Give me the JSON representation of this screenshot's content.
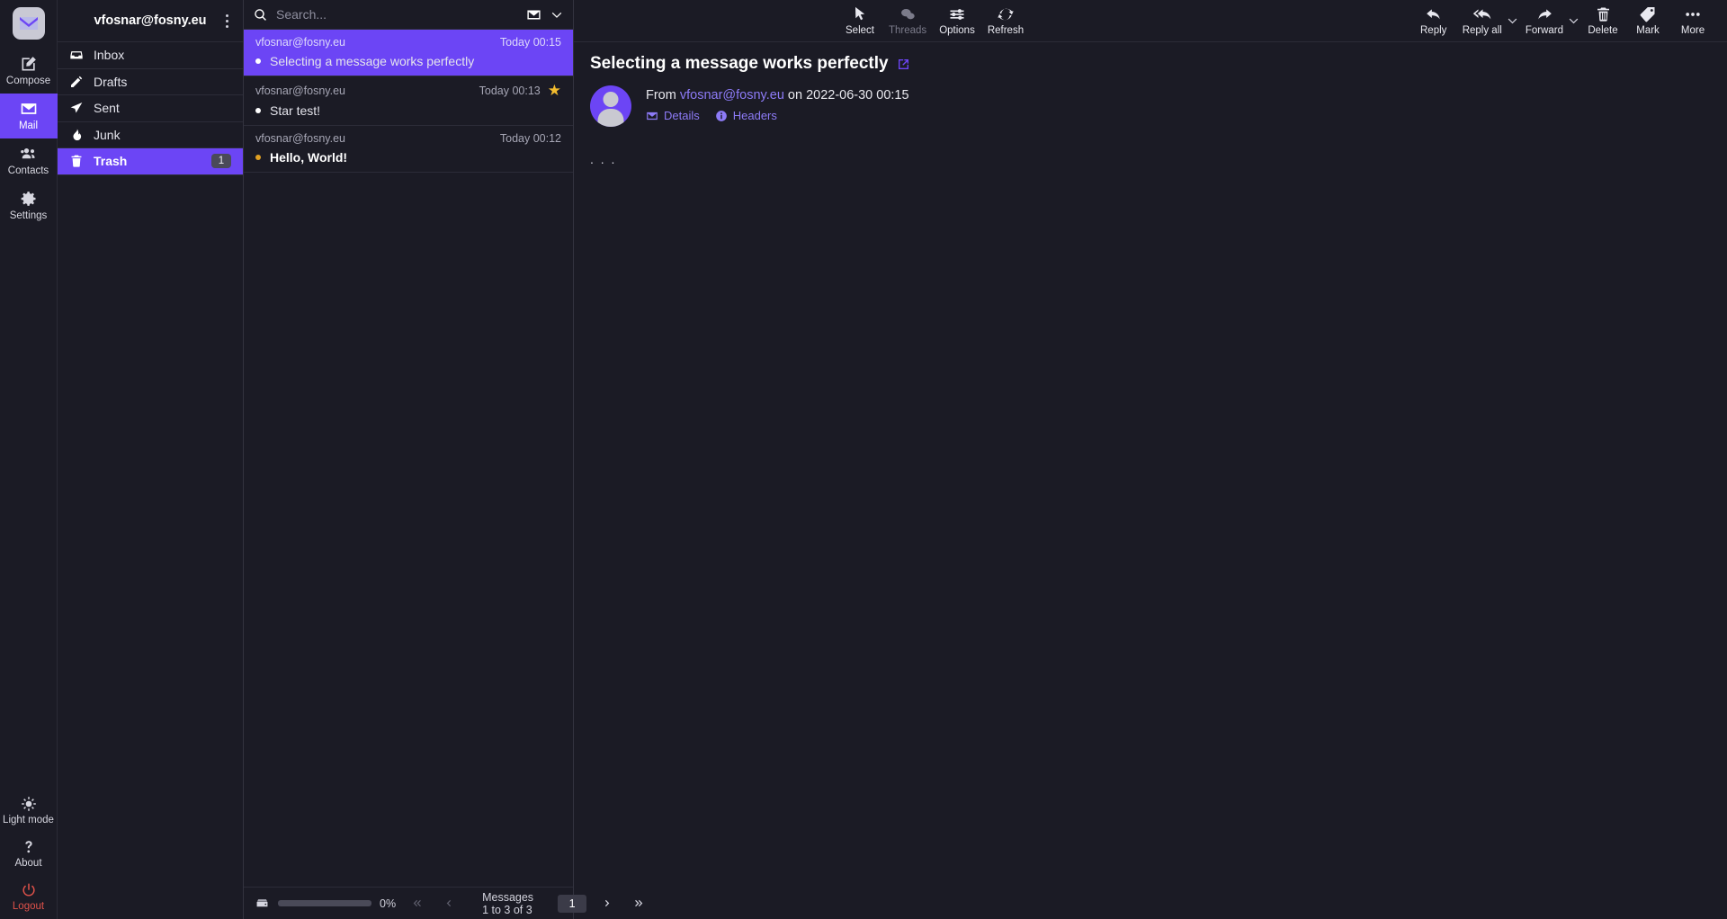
{
  "rail": {
    "logo_icon": "mail-logo-icon",
    "items": [
      {
        "label": "Compose",
        "icon": "compose-pencil-icon",
        "active": false
      },
      {
        "label": "Mail",
        "icon": "envelope-icon",
        "active": true
      },
      {
        "label": "Contacts",
        "icon": "people-icon",
        "active": false
      },
      {
        "label": "Settings",
        "icon": "gear-icon",
        "active": false
      }
    ],
    "bottom_items": [
      {
        "label": "Light mode",
        "icon": "sun-icon"
      },
      {
        "label": "About",
        "icon": "question-icon"
      },
      {
        "label": "Logout",
        "icon": "power-icon"
      }
    ]
  },
  "folders": {
    "account": "vfosnar@fosny.eu",
    "items": [
      {
        "label": "Inbox",
        "icon": "inbox-icon",
        "count": "",
        "active": false
      },
      {
        "label": "Drafts",
        "icon": "pencil-icon",
        "count": "",
        "active": false
      },
      {
        "label": "Sent",
        "icon": "send-icon",
        "count": "",
        "active": false
      },
      {
        "label": "Junk",
        "icon": "fire-icon",
        "count": "",
        "active": false
      },
      {
        "label": "Trash",
        "icon": "trash-icon",
        "count": "1",
        "active": true
      }
    ]
  },
  "search": {
    "placeholder": "Search...",
    "scope_icon": "envelope-icon",
    "dropdown_icon": "chevron-down-icon"
  },
  "messages": [
    {
      "from": "vfosnar@fosny.eu",
      "date": "Today 00:15",
      "subject": "Selecting a message works perfectly",
      "selected": true,
      "unread": false,
      "starred": false
    },
    {
      "from": "vfosnar@fosny.eu",
      "date": "Today 00:13",
      "subject": "Star test!",
      "selected": false,
      "unread": false,
      "starred": true
    },
    {
      "from": "vfosnar@fosny.eu",
      "date": "Today 00:12",
      "subject": "Hello, World!",
      "selected": false,
      "unread": true,
      "starred": false
    }
  ],
  "footer": {
    "quota_percent": "0%",
    "quota_icon": "disk-icon",
    "status": "Messages 1 to 3 of 3",
    "page_value": "1",
    "first_icon": "double-chevron-left-icon",
    "prev_icon": "chevron-left-icon",
    "next_icon": "chevron-right-icon",
    "last_icon": "double-chevron-right-icon"
  },
  "toolbar": {
    "left": [
      {
        "label": "Select",
        "icon": "cursor-icon",
        "disabled": false
      },
      {
        "label": "Threads",
        "icon": "threads-icon",
        "disabled": true
      },
      {
        "label": "Options",
        "icon": "sliders-icon",
        "disabled": false
      },
      {
        "label": "Refresh",
        "icon": "refresh-icon",
        "disabled": false
      }
    ],
    "right": [
      {
        "label": "Reply",
        "icon": "reply-icon",
        "caret": false
      },
      {
        "label": "Reply all",
        "icon": "reply-all-icon",
        "caret": true
      },
      {
        "label": "Forward",
        "icon": "forward-icon",
        "caret": true
      },
      {
        "label": "Delete",
        "icon": "trash-icon",
        "caret": false
      },
      {
        "label": "Mark",
        "icon": "tag-icon",
        "caret": false
      },
      {
        "label": "More",
        "icon": "ellipsis-icon",
        "caret": false
      }
    ]
  },
  "preview": {
    "subject": "Selecting a message works perfectly",
    "open_icon": "open-external-icon",
    "from_prefix": "From",
    "from_address": "vfosnar@fosny.eu",
    "on_text": "on 2022-06-30 00:15",
    "details_label": "Details",
    "details_icon": "envelope-icon",
    "headers_label": "Headers",
    "headers_icon": "info-icon",
    "body": ". . ."
  },
  "colors": {
    "accent": "#6c45f5",
    "background": "#1b1b25",
    "star": "#f3bc2e",
    "unread_dot": "#e0a022",
    "logout": "#e0524a"
  }
}
